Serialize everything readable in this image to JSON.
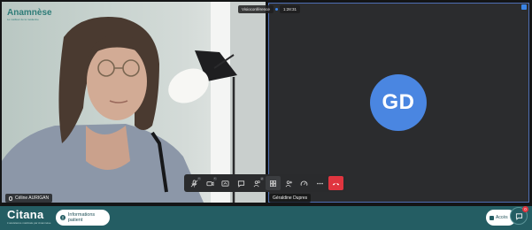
{
  "overlay": {
    "brand_name": "Anamnèse",
    "brand_tagline": "Le meilleur de la médecine",
    "service_name": "Visioconférence",
    "call_timer": "1:28:31"
  },
  "participants": {
    "local": {
      "name": "Céline AURIGAN"
    },
    "remote": {
      "name": "Géraldine Dupres",
      "initials": "GD",
      "avatar_color": "#4a86e1"
    }
  },
  "toolbar": {
    "buttons": [
      {
        "icon": "microphone-icon"
      },
      {
        "icon": "camera-icon"
      },
      {
        "icon": "screen-share-icon"
      },
      {
        "icon": "chat-icon"
      },
      {
        "icon": "participants-icon"
      },
      {
        "icon": "grid-view-icon"
      },
      {
        "icon": "invite-icon"
      },
      {
        "icon": "speed-icon"
      },
      {
        "icon": "more-icon"
      },
      {
        "icon": "hang-up-icon"
      }
    ],
    "hangup_color": "#e0353f"
  },
  "bottombar": {
    "logo_name": "Citana",
    "logo_tagline": "L'assistance médicale par Anamnèse",
    "patient_button_label": "Informations patient",
    "right_button_label": "Accès",
    "chat_badge": "0",
    "bar_color": "#245d63"
  }
}
